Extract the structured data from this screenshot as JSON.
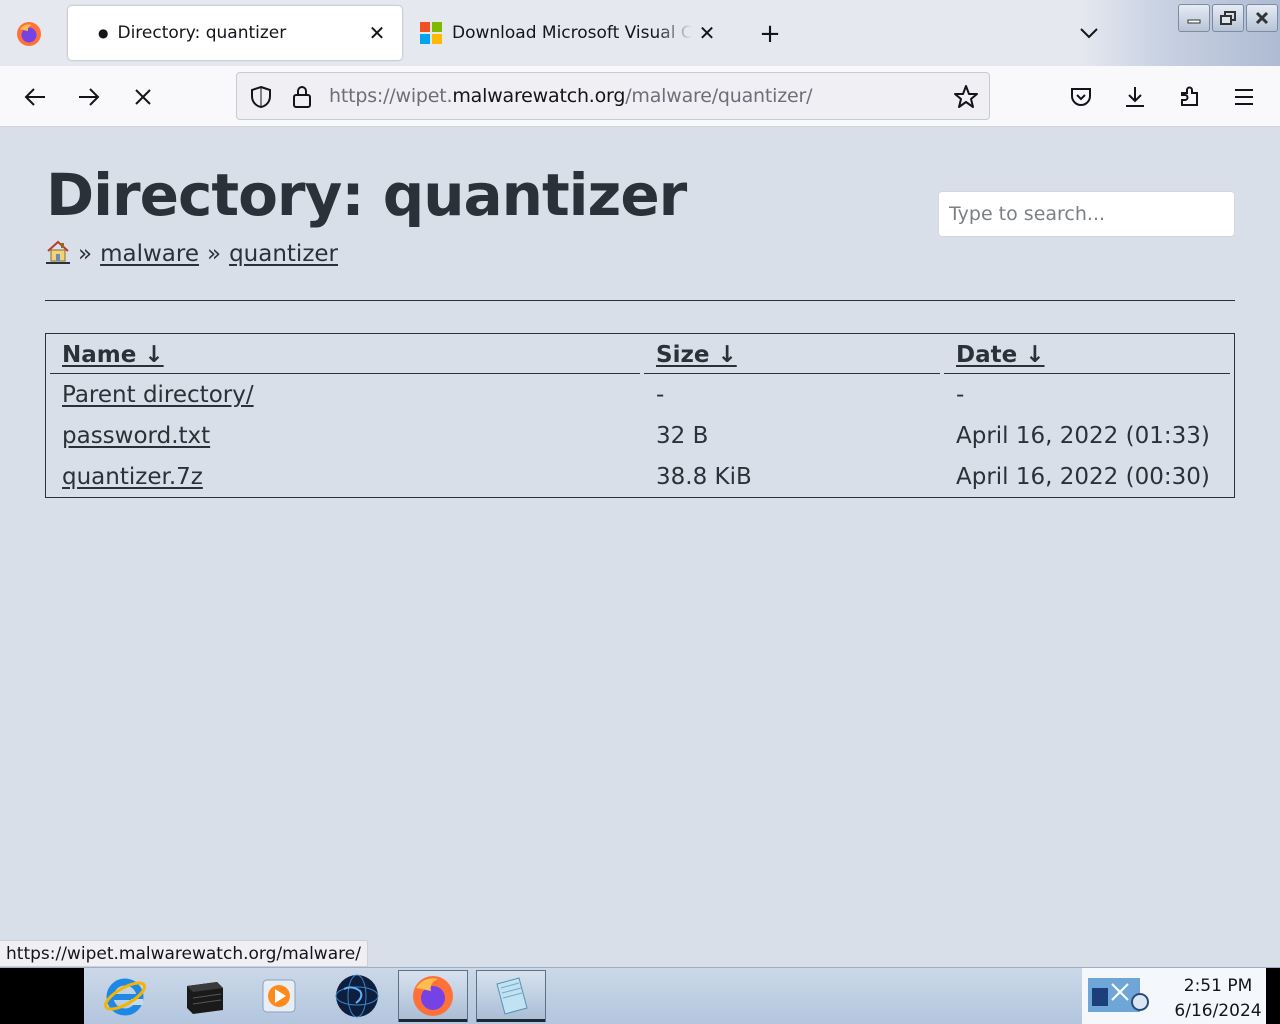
{
  "browser": {
    "tabs": [
      {
        "title": "Directory: quantizer",
        "active": true
      },
      {
        "title": "Download Microsoft Visual C++",
        "active": false
      }
    ],
    "url_prefix": "https://wipet.",
    "url_host": "malwarewatch.org",
    "url_path": "/malware/quantizer/",
    "status_url": "https://wipet.malwarewatch.org/malware/"
  },
  "page": {
    "title": "Directory: quantizer",
    "search_placeholder": "Type to search...",
    "breadcrumb": {
      "separator": "»",
      "items": [
        "malware",
        "quantizer"
      ]
    },
    "table": {
      "headers": [
        "Name ↓",
        "Size ↓",
        "Date ↓"
      ],
      "rows": [
        {
          "name": "Parent directory/",
          "size": "-",
          "date": "-"
        },
        {
          "name": "password.txt",
          "size": "32 B",
          "date": "April 16, 2022 (01:33)"
        },
        {
          "name": "quantizer.7z",
          "size": "38.8 KiB",
          "date": "April 16, 2022 (00:30)"
        }
      ]
    }
  },
  "taskbar": {
    "time": "2:51 PM",
    "date": "6/16/2024"
  },
  "colors": {
    "page_bg": "#d8dfe8",
    "text": "#2b3138",
    "firefox_orange": "#ff7139",
    "firefox_purple": "#7542e5"
  }
}
